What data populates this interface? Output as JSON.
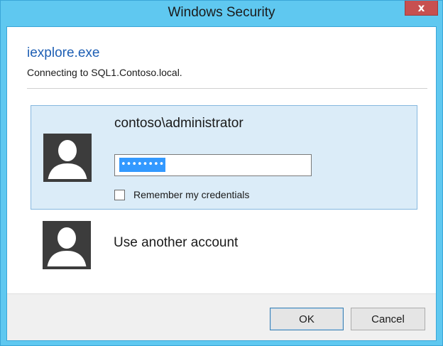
{
  "window": {
    "title": "Windows Security",
    "close_glyph": "x"
  },
  "header": {
    "app_name": "iexplore.exe",
    "subtitle": "Connecting to SQL1.Contoso.local."
  },
  "selected_account": {
    "name": "contoso\\administrator",
    "password_value": "••••••••",
    "remember_label": "Remember my credentials",
    "remember_checked": false,
    "avatar_icon": "user-silhouette-icon"
  },
  "other_account": {
    "label": "Use another account",
    "avatar_icon": "user-silhouette-icon"
  },
  "buttons": {
    "ok": "OK",
    "cancel": "Cancel"
  },
  "colors": {
    "titlebar": "#5fc8f0",
    "close_button": "#c75050",
    "selection_bg": "#dbecf8",
    "link_blue": "#1e5fb4"
  }
}
